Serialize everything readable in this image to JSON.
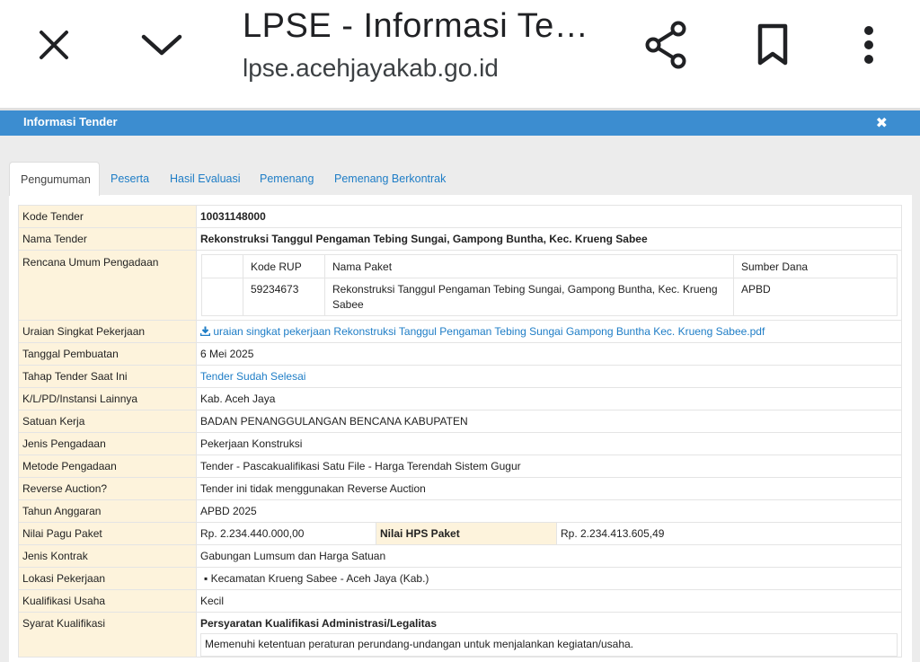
{
  "browser": {
    "title": "LPSE - Informasi Te…",
    "url": "lpse.acehjayakab.go.id",
    "icons": [
      "close-icon",
      "chevron-down-icon",
      "share-icon",
      "bookmark-icon",
      "more-vert-icon"
    ]
  },
  "modal": {
    "title": "Informasi Tender",
    "close": "✖"
  },
  "tabs": [
    "Pengumuman",
    "Peserta",
    "Hasil Evaluasi",
    "Pemenang",
    "Pemenang Berkontrak"
  ],
  "rows": {
    "kode_tender": {
      "label": "Kode Tender",
      "value": "10031148000"
    },
    "nama_tender": {
      "label": "Nama Tender",
      "value": "Rekonstruksi Tanggul Pengaman Tebing Sungai, Gampong Buntha, Kec. Krueng Sabee"
    },
    "rup": {
      "label": "Rencana Umum Pengadaan",
      "headers": [
        "Kode RUP",
        "Nama Paket",
        "Sumber Dana"
      ],
      "row": [
        "59234673",
        "Rekonstruksi Tanggul Pengaman Tebing Sungai, Gampong Buntha, Kec. Krueng Sabee",
        "APBD"
      ]
    },
    "uraian": {
      "label": "Uraian Singkat Pekerjaan",
      "value": "uraian singkat pekerjaan Rekonstruksi Tanggul Pengaman Tebing Sungai Gampong Buntha Kec. Krueng Sabee.pdf"
    },
    "tanggal": {
      "label": "Tanggal Pembuatan",
      "value": "6 Mei 2025"
    },
    "tahap": {
      "label": "Tahap Tender Saat Ini",
      "value": "Tender Sudah Selesai"
    },
    "klpd": {
      "label": "K/L/PD/Instansi Lainnya",
      "value": "Kab. Aceh Jaya"
    },
    "satker": {
      "label": "Satuan Kerja",
      "value": "BADAN PENANGGULANGAN BENCANA KABUPATEN"
    },
    "jenis": {
      "label": "Jenis Pengadaan",
      "value": "Pekerjaan Konstruksi"
    },
    "metode": {
      "label": "Metode Pengadaan",
      "value": "Tender - Pascakualifikasi Satu File - Harga Terendah Sistem Gugur"
    },
    "reverse": {
      "label": "Reverse Auction?",
      "value": "Tender ini tidak menggunakan Reverse Auction"
    },
    "tahun": {
      "label": "Tahun Anggaran",
      "value": "APBD 2025"
    },
    "pagu": {
      "label": "Nilai Pagu Paket",
      "value": "Rp. 2.234.440.000,00",
      "hps_label": "Nilai HPS Paket",
      "hps_value": "Rp. 2.234.413.605,49"
    },
    "kontrak": {
      "label": "Jenis Kontrak",
      "value": "Gabungan Lumsum dan Harga Satuan"
    },
    "lokasi": {
      "label": "Lokasi Pekerjaan",
      "value": "Kecamatan Krueng Sabee - Aceh Jaya (Kab.)"
    },
    "kualifikasi": {
      "label": "Kualifikasi Usaha",
      "value": "Kecil"
    },
    "syarat": {
      "label": "Syarat Kualifikasi",
      "heading": "Persyaratan Kualifikasi Administrasi/Legalitas",
      "item": "Memenuhi ketentuan peraturan perundang-undangan untuk menjalankan kegiatan/usaha."
    }
  }
}
